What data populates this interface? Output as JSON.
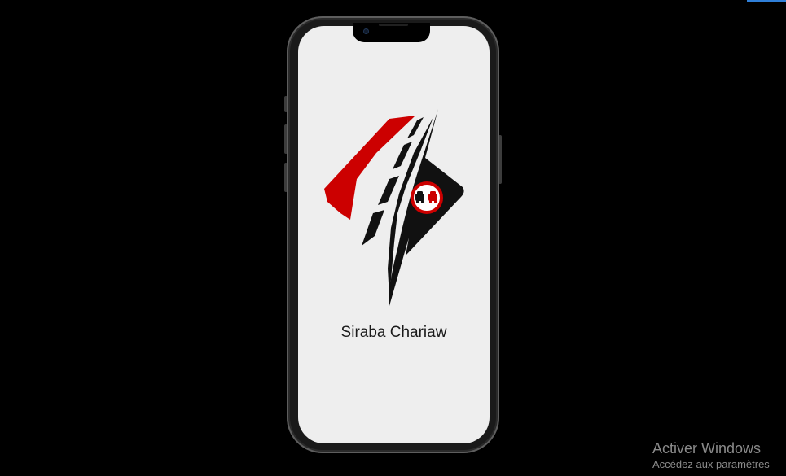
{
  "app": {
    "title": "Siraba Chariaw"
  },
  "logo": {
    "icon": "road-logo-icon",
    "badge_icon": "no-overtaking-sign-icon",
    "colors": {
      "red": "#cc0000",
      "black": "#111111"
    }
  },
  "device": {
    "frame_icon": "phone-frame"
  },
  "watermark": {
    "title": "Activer Windows",
    "subtitle": "Accédez aux paramètres"
  },
  "colors": {
    "background": "#000000",
    "screen": "#eeeeee",
    "text": "#1a1a1a",
    "watermark": "#8a8a8a"
  }
}
